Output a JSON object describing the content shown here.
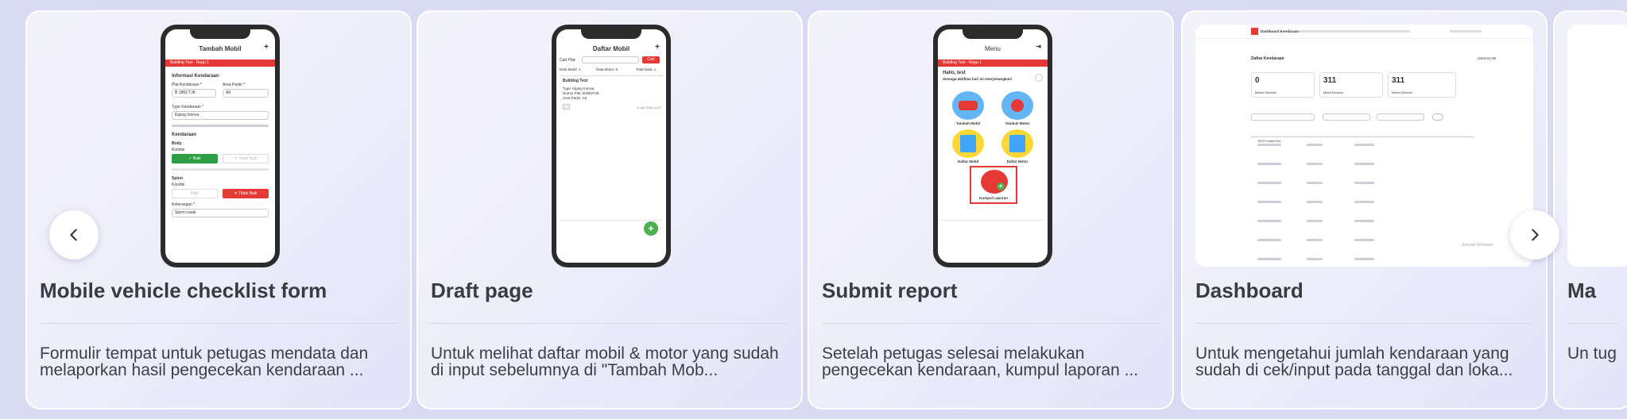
{
  "cards": [
    {
      "title": "Mobile vehicle checklist form",
      "description": "Formulir tempat untuk petugas mendata dan melaporkan hasil pengecekan kendaraan ..."
    },
    {
      "title": "Draft page",
      "description": "Untuk melihat daftar mobil & motor yang sudah di input sebelumnya di \"Tambah Mob..."
    },
    {
      "title": "Submit report",
      "description": "Setelah petugas selesai melakukan pengecekan kendaraan, kumpul laporan ..."
    },
    {
      "title": "Dashboard",
      "description": "Untuk mengetahui jumlah kendaraan yang sudah di cek/input pada tanggal dan loka..."
    },
    {
      "title": "Ma",
      "description": "Un tug"
    }
  ],
  "screens": {
    "tambah_mobil": {
      "title": "Tambah Mobil",
      "location": "Building Test - Regu 1",
      "section_info": "Informasi Kendaraan",
      "plat_label": "Plat Kendaraan *",
      "plat_value": "B 1882 TJK",
      "area_label": "Area Parkir *",
      "area_value": "A6",
      "type_label": "Type Kendaraan *",
      "type_value": "Kijang Innova",
      "section_kendaraan": "Kendaraan",
      "body_label": "Body",
      "kondisi_label": "Kondisi",
      "baik_label": "Baik",
      "tidak_baik_label": "Tidak Baik",
      "spion_label": "Spion",
      "keterangan_label": "Keterangan *",
      "keterangan_value": "Spion rusak"
    },
    "daftar_mobil": {
      "title": "Daftar Mobil",
      "cari_label": "Cari Plat:",
      "cari_button": "Cari",
      "col1": "Data Mobil: 1",
      "col2": "Data Motor: 0",
      "col3": "Total Data: 1",
      "item_building": "Building Test",
      "item_type": "Type: Kijang Innova",
      "item_plat": "Nomor Plat: B1882TJK",
      "item_area": "Area Parkir: A6",
      "item_date": "9 Jan 2024 11:27"
    },
    "menu": {
      "title": "Menu",
      "location": "Building Test - Regu 1",
      "greeting": "Hallo, test",
      "subgreeting": "Semoga aktifitas hari ini menyenangkan!",
      "tambah_mobil": "Tambah Mobil",
      "tambah_motor": "Tambah Motor",
      "daftar_mobil": "Daftar Mobil",
      "daftar_motor": "Daftar Motor",
      "kumpul_laporan": "Kumpul Laporan"
    },
    "dashboard": {
      "header_title": "Dashboard Kendaraan",
      "page_title": "Daftar Kendaraan",
      "date": "2023-01-08",
      "stat1_value": "0",
      "stat1_label": "Belum Dicheck",
      "stat2_value": "311",
      "stat2_label": "Mobil Dicheck",
      "stat3_value": "311",
      "stat3_label": "Motor Dicheck",
      "table_rows": 8,
      "table_first_col": "TEST-mobil-FA1",
      "watermark": "Activate Windows"
    }
  },
  "nav": {
    "prev_icon": "chevron-left-icon",
    "next_icon": "chevron-right-icon"
  },
  "colors": {
    "background": "#d8dbf3",
    "accent_red": "#e53935",
    "accent_green": "#2e9e45",
    "title_text": "#3b3c42"
  }
}
